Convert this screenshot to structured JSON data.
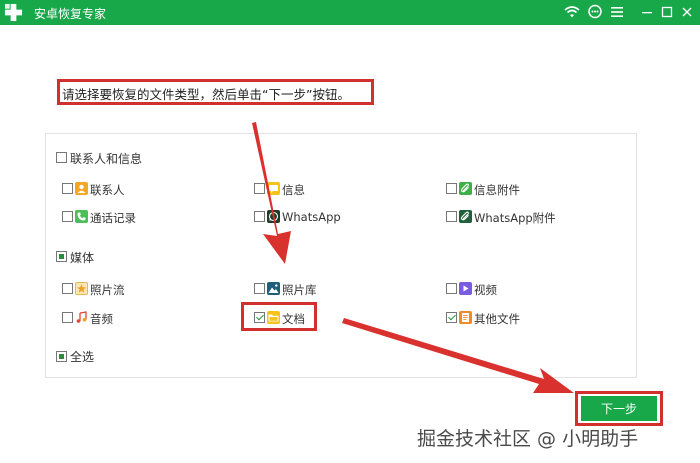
{
  "app": {
    "title": "安卓恢复专家",
    "accent": "#18a84a",
    "highlight": "#d0312d"
  },
  "titlebar": {
    "icons": [
      "wifi-icon",
      "chat-icon",
      "menu-icon",
      "minimize-icon",
      "maximize-icon",
      "close-icon"
    ]
  },
  "instruction": "请选择要恢复的文件类型，然后单击“下一步”按钮。",
  "groups": {
    "contacts": {
      "label": "联系人和信息",
      "items": [
        {
          "label": "联系人",
          "checked": false,
          "icon": "contacts-icon"
        },
        {
          "label": "信息",
          "checked": false,
          "icon": "message-icon"
        },
        {
          "label": "信息附件",
          "checked": false,
          "icon": "attachment-icon"
        },
        {
          "label": "通话记录",
          "checked": false,
          "icon": "phone-icon"
        },
        {
          "label": "WhatsApp",
          "checked": false,
          "icon": "whatsapp-icon"
        },
        {
          "label": "WhatsApp附件",
          "checked": false,
          "icon": "whatsapp-attachment-icon"
        }
      ]
    },
    "media": {
      "label": "媒体",
      "state": "partial",
      "items": [
        {
          "label": "照片流",
          "checked": false,
          "icon": "photostream-icon"
        },
        {
          "label": "照片库",
          "checked": false,
          "icon": "photo-library-icon"
        },
        {
          "label": "视频",
          "checked": false,
          "icon": "video-icon"
        },
        {
          "label": "音频",
          "checked": false,
          "icon": "audio-icon"
        },
        {
          "label": "文档",
          "checked": true,
          "icon": "folder-icon"
        },
        {
          "label": "其他文件",
          "checked": true,
          "icon": "other-files-icon"
        }
      ]
    },
    "select_all": {
      "label": "全选",
      "state": "partial"
    }
  },
  "next_button": {
    "label": "下一步"
  },
  "watermark": "掘金技术社区 @ 小明助手"
}
